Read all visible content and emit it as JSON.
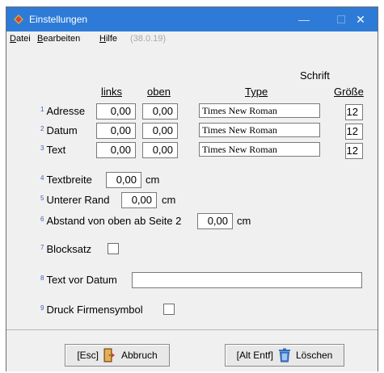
{
  "window": {
    "title": "Einstellungen",
    "controls": {
      "minimize": "—",
      "close": "✕"
    }
  },
  "menu": {
    "items": [
      "Datei",
      "Bearbeiten",
      "Hilfe"
    ],
    "accelerators": [
      "D",
      "B",
      "H"
    ],
    "version": "(38.0.19)"
  },
  "form": {
    "section_title": "Schrift",
    "columns": {
      "links": "links",
      "oben": "oben",
      "type": "Type",
      "groesse": "Größe"
    },
    "rows": [
      {
        "num": "1",
        "label": "Adresse",
        "links": "0,00",
        "oben": "0,00",
        "type": "Times New Roman",
        "size": "12"
      },
      {
        "num": "2",
        "label": "Datum",
        "links": "0,00",
        "oben": "0,00",
        "type": "Times New Roman",
        "size": "12"
      },
      {
        "num": "3",
        "label": "Text",
        "links": "0,00",
        "oben": "0,00",
        "type": "Times New Roman",
        "size": "12"
      }
    ],
    "textbreite": {
      "num": "4",
      "label": "Textbreite",
      "value": "0,00",
      "unit": "cm"
    },
    "unterer_rand": {
      "num": "5",
      "label": "Unterer Rand",
      "value": "0,00",
      "unit": "cm"
    },
    "abstand": {
      "num": "6",
      "label": "Abstand von oben ab Seite 2",
      "value": "0,00",
      "unit": "cm"
    },
    "blocksatz": {
      "num": "7",
      "label": "Blocksatz",
      "checked": false
    },
    "text_vor_datum": {
      "num": "8",
      "label": "Text vor Datum",
      "value": ""
    },
    "druck_firmensymbol": {
      "num": "9",
      "label": "Druck Firmensymbol",
      "checked": false
    }
  },
  "buttons": {
    "abbruch": {
      "key": "[Esc]",
      "label": "Abbruch",
      "icon": "exit-door-icon"
    },
    "loeschen": {
      "key": "[Alt Entf]",
      "label": "Löschen",
      "icon": "trash-icon"
    }
  },
  "colors": {
    "titlebar": "#2d7bd7",
    "superscript": "#3c5fb6"
  }
}
